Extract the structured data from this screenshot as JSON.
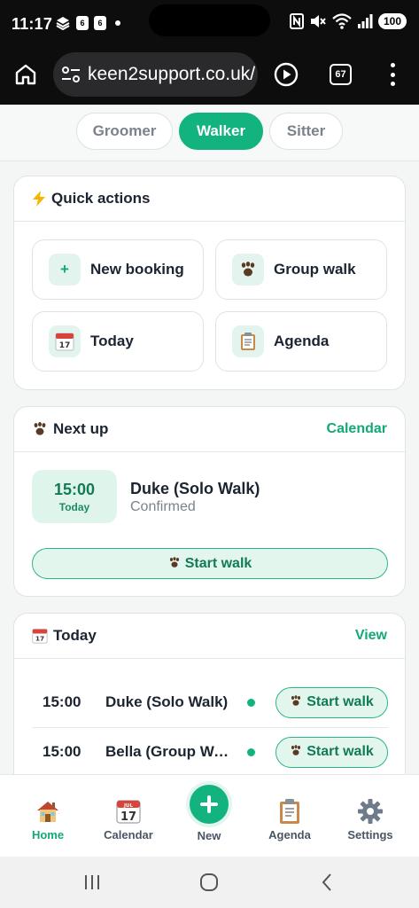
{
  "status_bar": {
    "time": "11:17",
    "notification_badges": [
      "6",
      "6"
    ],
    "battery": "100"
  },
  "browser": {
    "url": "keen2support.co.uk/",
    "tab_count": "67"
  },
  "role_tabs": [
    {
      "label": "Groomer",
      "active": false
    },
    {
      "label": "Walker",
      "active": true
    },
    {
      "label": "Sitter",
      "active": false
    }
  ],
  "quick_actions": {
    "title": "Quick actions",
    "items": [
      {
        "label": "New booking",
        "icon": "plus-icon"
      },
      {
        "label": "Group walk",
        "icon": "paw-icon"
      },
      {
        "label": "Today",
        "icon": "calendar-icon"
      },
      {
        "label": "Agenda",
        "icon": "clipboard-icon"
      }
    ]
  },
  "next_up": {
    "title": "Next up",
    "link": "Calendar",
    "time": "15:00",
    "day": "Today",
    "name": "Duke (Solo Walk)",
    "status": "Confirmed",
    "action": "Start walk"
  },
  "today": {
    "title": "Today",
    "link": "View",
    "rows": [
      {
        "time": "15:00",
        "name": "Duke (Solo Walk)",
        "action": "Start walk"
      },
      {
        "time": "15:00",
        "name": "Bella (Group Walk)",
        "action": "Start walk"
      }
    ]
  },
  "bottom_nav": {
    "items": [
      {
        "label": "Home",
        "icon": "house-icon",
        "active": true
      },
      {
        "label": "Calendar",
        "icon": "calendar-icon",
        "active": false
      },
      {
        "label": "New",
        "icon": "plus-icon",
        "active": false
      },
      {
        "label": "Agenda",
        "icon": "clipboard-icon",
        "active": false
      },
      {
        "label": "Settings",
        "icon": "gear-icon",
        "active": false
      }
    ]
  },
  "colors": {
    "accent": "#12b37e",
    "accent_dark": "#137a57",
    "accent_light": "#e3f6ee"
  }
}
